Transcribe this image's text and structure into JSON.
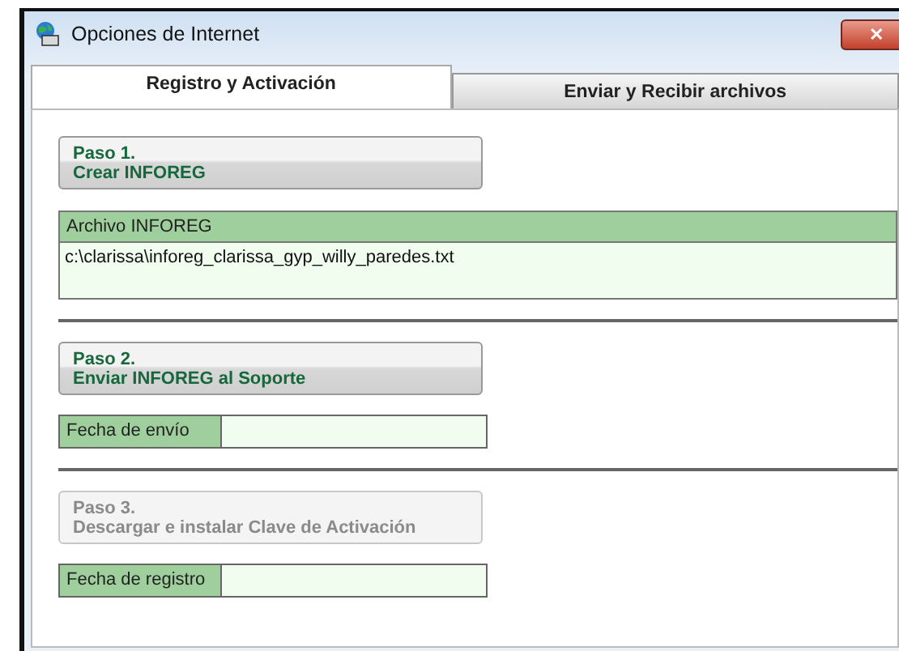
{
  "window": {
    "title": "Opciones de Internet",
    "close": "✕"
  },
  "tabs": [
    {
      "label": "Registro y Activación",
      "selected": true
    },
    {
      "label": "Enviar y Recibir archivos",
      "selected": false
    }
  ],
  "sections": [
    {
      "step": "Paso 1.",
      "action": "Crear INFOREG",
      "disabled": false,
      "field": {
        "kind": "panel",
        "label": "Archivo INFOREG",
        "value": "c:\\clarissa\\inforeg_clarissa_gyp_willy_paredes.txt"
      }
    },
    {
      "step": "Paso 2.",
      "action": "Enviar INFOREG al Soporte",
      "disabled": false,
      "field": {
        "kind": "inline",
        "label": "Fecha de envío"
      }
    },
    {
      "step": "Paso 3.",
      "action": "Descargar e instalar Clave de Activación",
      "disabled": true,
      "field": {
        "kind": "inline",
        "label": "Fecha de registro"
      }
    }
  ]
}
